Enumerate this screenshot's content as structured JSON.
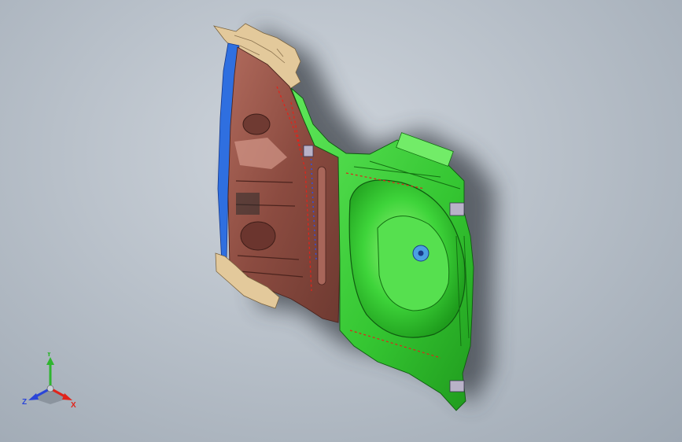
{
  "viewport": {
    "background_color": "#b9c1ca"
  },
  "model": {
    "parts": [
      {
        "name": "left-panel",
        "color": "#8f4f44"
      },
      {
        "name": "right-panel",
        "color": "#3fd43a"
      },
      {
        "name": "top-bracket",
        "color": "#e2c89a"
      },
      {
        "name": "bottom-bracket",
        "color": "#e2c89a"
      },
      {
        "name": "edge-rail",
        "color": "#2f6fe0"
      }
    ]
  },
  "triad": {
    "x_label": "X",
    "y_label": "Y",
    "z_label": "Z",
    "x_color": "#e0241b",
    "y_color": "#2fb52f",
    "z_color": "#2a45d8"
  }
}
